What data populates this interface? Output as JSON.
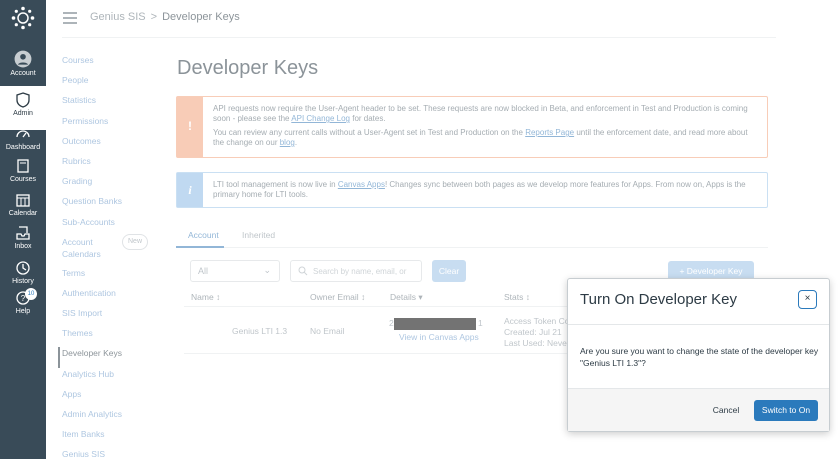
{
  "global_nav": {
    "items": [
      {
        "label": "Account",
        "icon": "account-icon"
      },
      {
        "label": "Admin",
        "icon": "shield-icon"
      },
      {
        "label": "Dashboard",
        "icon": "dashboard-icon"
      },
      {
        "label": "Courses",
        "icon": "book-icon"
      },
      {
        "label": "Calendar",
        "icon": "calendar-icon"
      },
      {
        "label": "Inbox",
        "icon": "inbox-icon"
      },
      {
        "label": "History",
        "icon": "clock-icon"
      },
      {
        "label": "Help",
        "icon": "help-icon",
        "badge": "10"
      }
    ]
  },
  "breadcrumb": {
    "root": "Genius SIS",
    "separator": ">",
    "current": "Developer Keys"
  },
  "course_nav": {
    "items": [
      "Courses",
      "People",
      "Statistics",
      "Permissions",
      "Outcomes",
      "Rubrics",
      "Grading",
      "Question Banks",
      "Sub-Accounts",
      "Account Calendars",
      "Terms",
      "Authentication",
      "SIS Import",
      "Themes",
      "Developer Keys",
      "Analytics Hub",
      "Apps",
      "Admin Analytics",
      "Item Banks",
      "Genius SIS"
    ],
    "new_badge": "New",
    "active": "Developer Keys"
  },
  "main": {
    "title": "Developer Keys",
    "warning": {
      "icon": "!",
      "line1_pre": "API requests now require the User-Agent header to be set. These requests are now blocked in Beta, and enforcement in Test and Production is coming soon - please see the ",
      "line1_link": "API Change Log",
      "line1_post": " for dates.",
      "line2_pre": "You can review any current calls without a User-Agent set in Test and Production on the ",
      "line2_link": "Reports Page",
      "line2_mid": " until the enforcement date, and read more about the change on our ",
      "line2_link2": "blog",
      "line2_post": "."
    },
    "info": {
      "icon": "i",
      "pre": "LTI tool management is now live in ",
      "link": "Canvas Apps",
      "post": "! Changes sync between both pages as we develop more features for Apps. From now on, Apps is the primary home for LTI tools."
    },
    "tabs": [
      "Account",
      "Inherited"
    ],
    "filter": {
      "select_value": "All",
      "search_placeholder": "Search by name, email, or",
      "clear_label": "Clear",
      "add_label": "Developer Key",
      "add_icon": "+"
    },
    "table": {
      "headers": [
        "Name ↕",
        "Owner Email ↕",
        "Details ▾",
        "Stats ↕"
      ],
      "row": {
        "name": "Genius LTI 1.3",
        "email": "No Email",
        "details_pre": "2",
        "details_post": "1",
        "details_link": "View in Canvas Apps",
        "stats": [
          "Access Token Co",
          "Created: Jul 21",
          "Last Used: Neve"
        ]
      }
    }
  },
  "modal": {
    "title": "Turn On Developer Key",
    "close_label": "×",
    "body": "Are you sure you want to change the state of the developer key \"Genius LTI 1.3\"?",
    "cancel_label": "Cancel",
    "confirm_label": "Switch to On"
  }
}
